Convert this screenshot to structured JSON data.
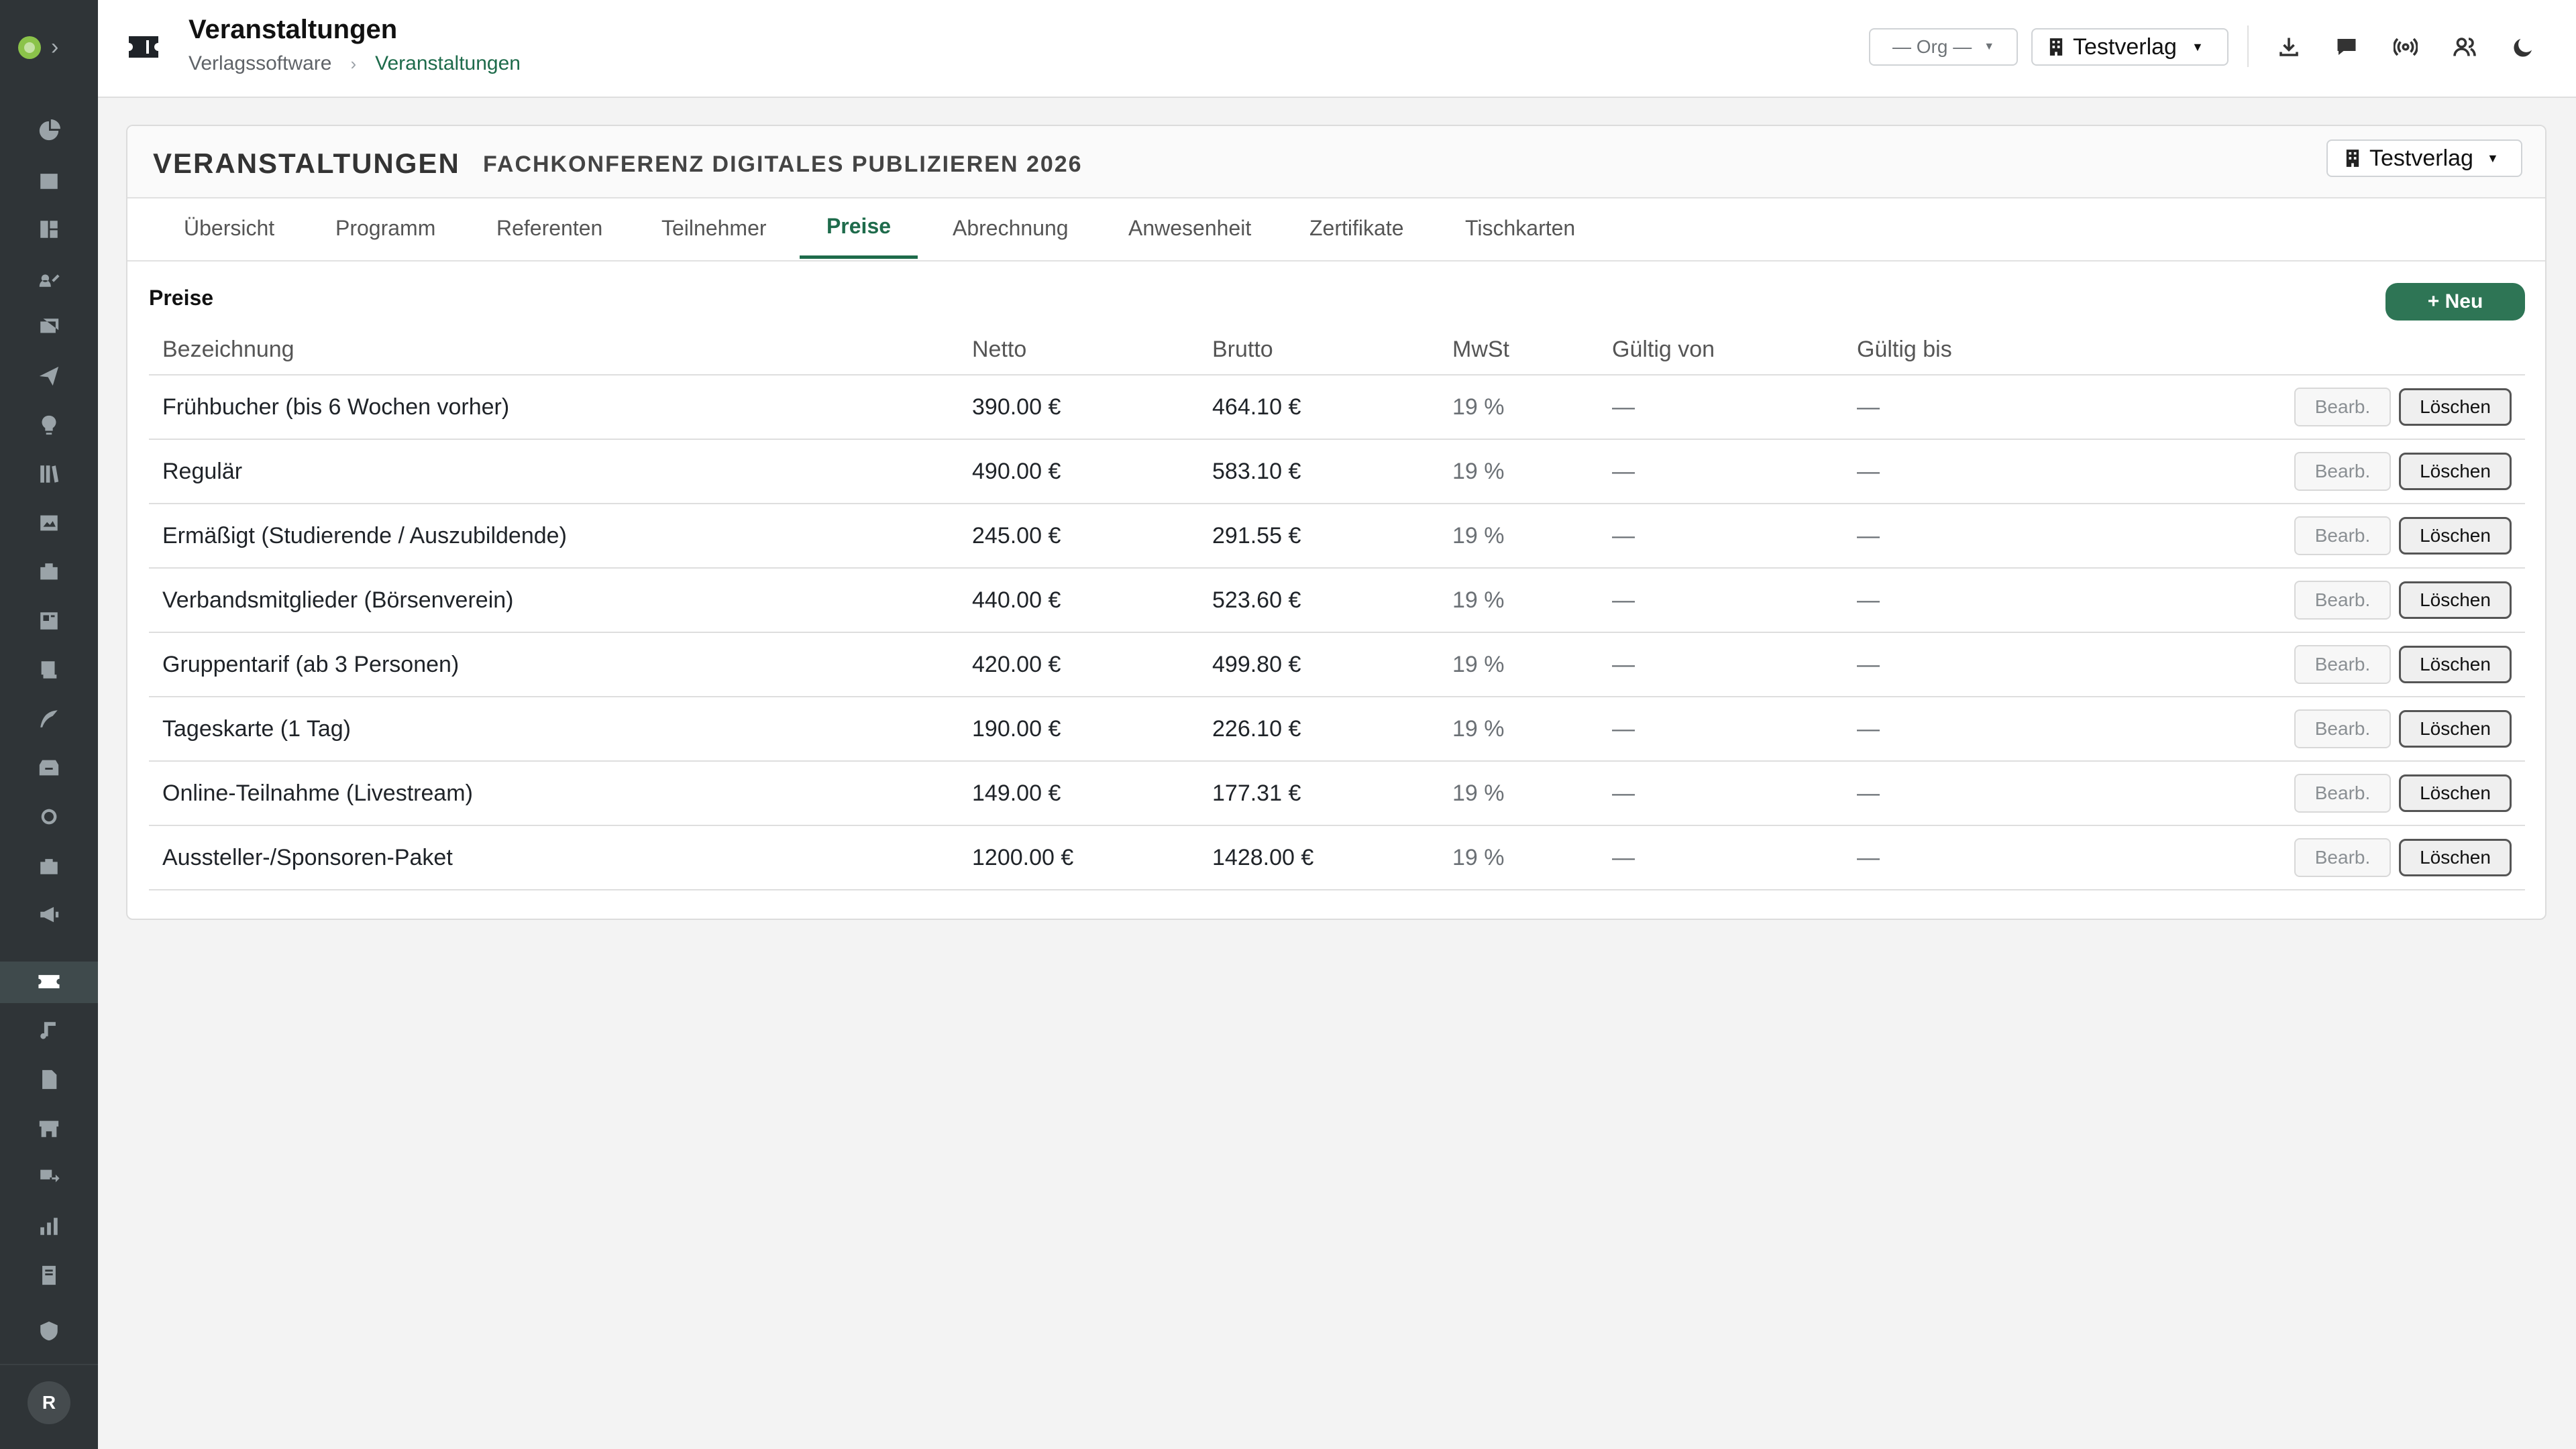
{
  "header": {
    "title": "Veranstaltungen",
    "breadcrumb": [
      "Verlagssoftware",
      "Veranstaltungen"
    ],
    "breadcrumb_sep": "›",
    "org_select": "— Org —",
    "publisher_select": "Testverlag",
    "actions": [
      "download-icon",
      "chat-icon",
      "broadcast-icon",
      "users-icon",
      "moon-icon"
    ]
  },
  "sidebar": {
    "avatar": "R",
    "active_item": "tickets",
    "icons": [
      "dashboard-icon",
      "calendar-icon",
      "layout-icon",
      "author-icon",
      "inbox-icon",
      "send-icon",
      "lightbulb-icon",
      "library-icon",
      "image-icon",
      "briefcase-icon",
      "frame-icon",
      "book-icon",
      "quill-icon",
      "archive-icon",
      "circle-icon",
      "bag-icon",
      "megaphone-icon",
      "ticket-icon",
      "music-icon",
      "document-icon",
      "store-icon",
      "transfer-icon",
      "chart-icon",
      "ledger-icon",
      "shield-icon"
    ]
  },
  "card": {
    "section": "VERANSTALTUNGEN",
    "event": "FACHKONFERENZ DIGITALES PUBLIZIEREN 2026",
    "publisher_select": "Testverlag",
    "tabs": [
      "Übersicht",
      "Programm",
      "Referenten",
      "Teilnehmer",
      "Preise",
      "Abrechnung",
      "Anwesenheit",
      "Zertifikate",
      "Tischkarten"
    ],
    "active_tab": "Preise"
  },
  "prices": {
    "title": "Preise",
    "new_button": "+ Neu",
    "edit_label": "Bearb.",
    "delete_label": "Löschen",
    "columns": [
      "Bezeichnung",
      "Netto",
      "Brutto",
      "MwSt",
      "Gültig von",
      "Gültig bis"
    ],
    "rows": [
      {
        "name": "Frühbucher (bis 6 Wochen vorher)",
        "netto": "390.00 €",
        "brutto": "464.10 €",
        "mwst": "19 %",
        "von": "—",
        "bis": "—"
      },
      {
        "name": "Regulär",
        "netto": "490.00 €",
        "brutto": "583.10 €",
        "mwst": "19 %",
        "von": "—",
        "bis": "—"
      },
      {
        "name": "Ermäßigt (Studierende / Auszubildende)",
        "netto": "245.00 €",
        "brutto": "291.55 €",
        "mwst": "19 %",
        "von": "—",
        "bis": "—"
      },
      {
        "name": "Verbandsmitglieder (Börsenverein)",
        "netto": "440.00 €",
        "brutto": "523.60 €",
        "mwst": "19 %",
        "von": "—",
        "bis": "—"
      },
      {
        "name": "Gruppentarif (ab 3 Personen)",
        "netto": "420.00 €",
        "brutto": "499.80 €",
        "mwst": "19 %",
        "von": "—",
        "bis": "—"
      },
      {
        "name": "Tageskarte (1 Tag)",
        "netto": "190.00 €",
        "brutto": "226.10 €",
        "mwst": "19 %",
        "von": "—",
        "bis": "—"
      },
      {
        "name": "Online-Teilnahme (Livestream)",
        "netto": "149.00 €",
        "brutto": "177.31 €",
        "mwst": "19 %",
        "von": "—",
        "bis": "—"
      },
      {
        "name": "Aussteller-/Sponsoren-Paket",
        "netto": "1200.00 €",
        "brutto": "1428.00 €",
        "mwst": "19 %",
        "von": "—",
        "bis": "—"
      }
    ]
  }
}
